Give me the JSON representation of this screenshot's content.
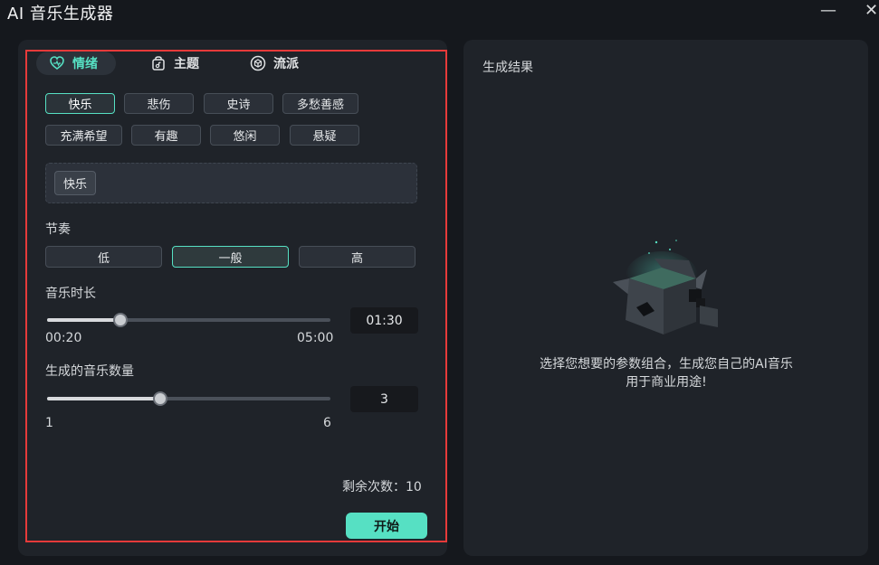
{
  "window": {
    "title": "AI 音乐生成器",
    "minimize_glyph": "—",
    "close_glyph": "✕"
  },
  "tabs": [
    {
      "label": "情绪",
      "icon": "heart-icon",
      "active": true
    },
    {
      "label": "主题",
      "icon": "bag-icon",
      "active": false
    },
    {
      "label": "流派",
      "icon": "cube-icon",
      "active": false
    }
  ],
  "moods": [
    {
      "label": "快乐",
      "selected": true
    },
    {
      "label": "悲伤",
      "selected": false
    },
    {
      "label": "史诗",
      "selected": false
    },
    {
      "label": "多愁善感",
      "selected": false
    },
    {
      "label": "充满希望",
      "selected": false
    },
    {
      "label": "有趣",
      "selected": false
    },
    {
      "label": "悠闲",
      "selected": false
    },
    {
      "label": "悬疑",
      "selected": false
    }
  ],
  "selected_tag": "快乐",
  "tempo": {
    "label": "节奏",
    "options": [
      "低",
      "一般",
      "高"
    ],
    "selected_index": 1
  },
  "duration": {
    "label": "音乐时长",
    "value": "01:30",
    "min_label": "00:20",
    "max_label": "05:00",
    "level": 0.26
  },
  "count": {
    "label": "生成的音乐数量",
    "value": "3",
    "min_label": "1",
    "max_label": "6",
    "level": 0.4
  },
  "remaining": "剩余次数：10",
  "start_label": "开始",
  "result": {
    "title": "生成结果",
    "empty_line1": "选择您想要的参数组合，生成您自己的AI音乐",
    "empty_line2": "用于商业用途!"
  },
  "colors": {
    "accent": "#56e0c3",
    "highlight_border": "#e63a3a",
    "panel": "#1f2329"
  }
}
